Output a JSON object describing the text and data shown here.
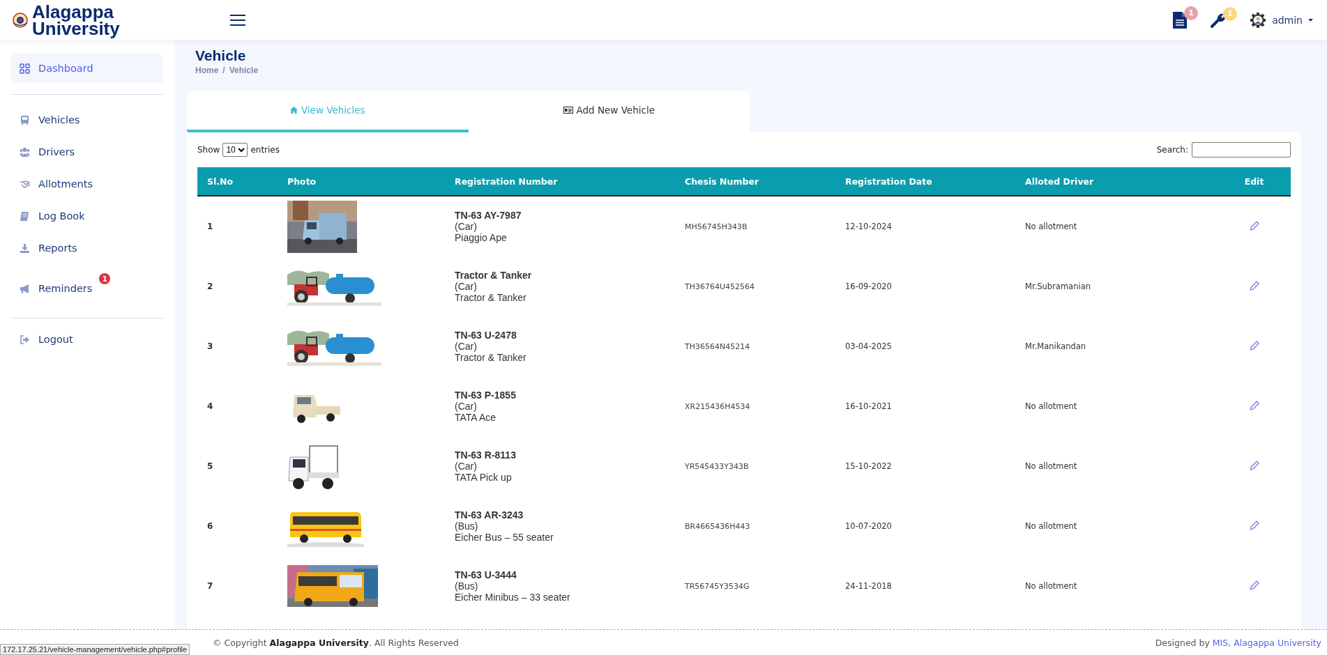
{
  "header": {
    "brand": "Alagappa\nUniversity",
    "notifications": [
      {
        "kind": "document",
        "count": "1",
        "color": "#eba1ab"
      },
      {
        "kind": "wrench",
        "count": "1",
        "color": "#fcd581"
      }
    ],
    "user": "admin"
  },
  "sidebar": {
    "sections": [
      {
        "items": [
          {
            "kind": "grid",
            "label": "Dashboard",
            "selected": true
          }
        ]
      },
      {
        "items": [
          {
            "kind": "bus",
            "label": "Vehicles",
            "selected": false
          },
          {
            "kind": "users",
            "label": "Drivers",
            "selected": false
          },
          {
            "kind": "handshake",
            "label": "Allotments",
            "selected": false
          },
          {
            "kind": "book",
            "label": "Log Book",
            "selected": false
          },
          {
            "kind": "download",
            "label": "Reports",
            "selected": false
          },
          {
            "kind": "megaphone",
            "label": "Reminders",
            "selected": false,
            "badge": "1"
          }
        ]
      },
      {
        "items": [
          {
            "kind": "logout",
            "label": "Logout",
            "selected": false
          }
        ]
      }
    ]
  },
  "page": {
    "title": "Vehicle",
    "breadcrumb": {
      "items": [
        "Home",
        "Vehicle"
      ],
      "separator": "/"
    }
  },
  "tabs": [
    {
      "kind": "home",
      "label": "View Vehicles",
      "selected": true
    },
    {
      "kind": "card",
      "label": "Add New Vehicle",
      "selected": false
    }
  ],
  "table": {
    "length_label_before": "Show",
    "length_value": "10",
    "length_label_after": "entries",
    "search_label": "Search:",
    "columns": [
      "Sl.No",
      "Photo",
      "Registration Number",
      "Chesis Number",
      "Registration Date",
      "Alloted Driver",
      "Edit"
    ],
    "rows": [
      {
        "sl": "1",
        "registration": {
          "number": "TN-63 AY-7987",
          "type": "(Car)",
          "model": "Piaggio Ape"
        },
        "chassis": "MH56745H343B",
        "date": "12-10-2024",
        "driver": "No allotment"
      },
      {
        "sl": "2",
        "registration": {
          "number": "Tractor & Tanker",
          "type": "(Car)",
          "model": "Tractor & Tanker"
        },
        "chassis": "TH36764U452564",
        "date": "16-09-2020",
        "driver": "Mr.Subramanian"
      },
      {
        "sl": "3",
        "registration": {
          "number": "TN-63 U-2478",
          "type": "(Car)",
          "model": "Tractor & Tanker"
        },
        "chassis": "TH36564N45214",
        "date": "03-04-2025",
        "driver": "Mr.Manikandan"
      },
      {
        "sl": "4",
        "registration": {
          "number": "TN-63 P-1855",
          "type": "(Car)",
          "model": "TATA Ace"
        },
        "chassis": "XR215436H4534",
        "date": "16-10-2021",
        "driver": "No allotment"
      },
      {
        "sl": "5",
        "registration": {
          "number": "TN-63 R-8113",
          "type": "(Car)",
          "model": "TATA Pick up"
        },
        "chassis": "YR545433Y343B",
        "date": "15-10-2022",
        "driver": "No allotment"
      },
      {
        "sl": "6",
        "registration": {
          "number": "TN-63 AR-3243",
          "type": "(Bus)",
          "model": "Eicher Bus – 55 seater"
        },
        "chassis": "BR4665436H443",
        "date": "10-07-2020",
        "driver": "No allotment"
      },
      {
        "sl": "7",
        "registration": {
          "number": "TN-63 U-3444",
          "type": "(Bus)",
          "model": "Eicher Minibus – 33 seater"
        },
        "chassis": "TR56745Y3534G",
        "date": "24-11-2018",
        "driver": "No allotment"
      }
    ]
  },
  "footer": {
    "copyright": "© Copyright **Alagappa University**. All Rights Reserved",
    "designed_by": "Designed by",
    "designer_link": "MIS, Alagappa University"
  },
  "status_url": "172.17.25.21/vehicle-management/vehicle.php#profile"
}
